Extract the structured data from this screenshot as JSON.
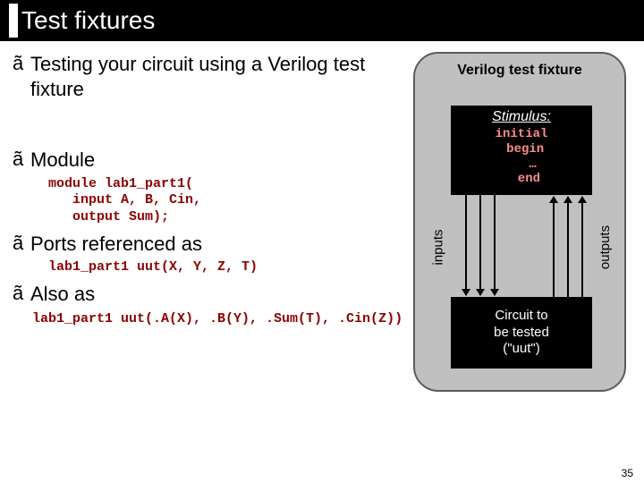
{
  "title": "Test fixtures",
  "bullets": {
    "b1": "Testing your circuit using a Verilog test fixture",
    "b2": "Module",
    "b3": "Ports referenced as",
    "b4": "Also as"
  },
  "marker": "ã",
  "code": {
    "mod_line1": "module lab1_part1(",
    "mod_line2": "   input A, B, Cin,",
    "mod_line3": "   output Sum);",
    "ports_ref": "lab1_part1 uut(X, Y, Z, T)",
    "also_as": "lab1_part1 uut(.A(X), .B(Y), .Sum(T), .Cin(Z))"
  },
  "fixture": {
    "title": "Verilog test fixture",
    "stim_title": "Stimulus:",
    "stim_code": "initial\n begin\n   …\n  end",
    "inputs_label": "inputs",
    "outputs_label": "outputs",
    "circuit_text": "Circuit to\nbe tested\n(\"uut\")"
  },
  "page_number": "35"
}
